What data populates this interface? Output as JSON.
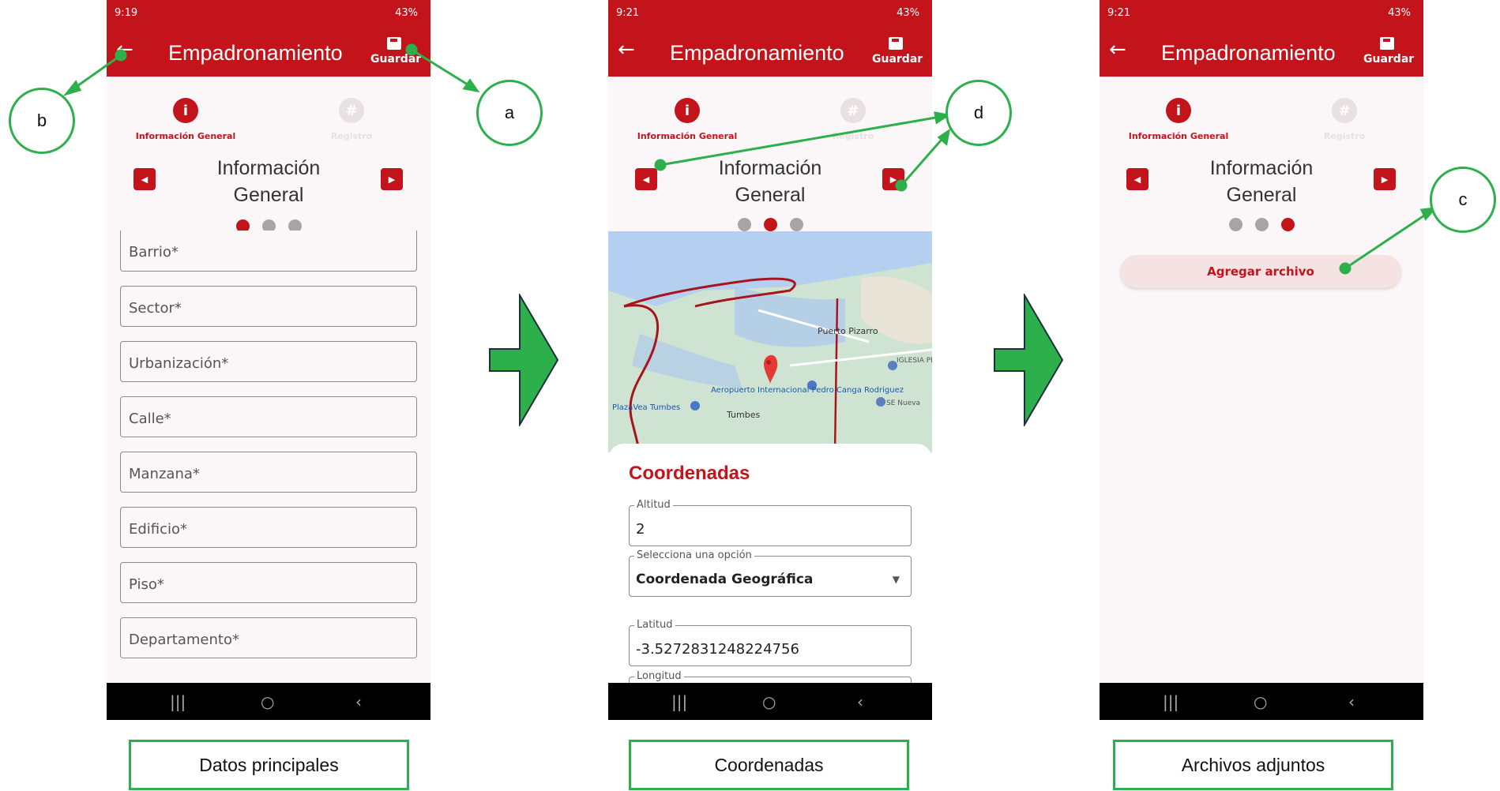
{
  "screens": [
    {
      "status_time": "9:19",
      "status_right": "43%",
      "app_title": "Empadronamiento",
      "save_label": "Guardar",
      "steps": [
        "Información General",
        "Registro"
      ],
      "section_title_1": "Información",
      "section_title_2": "General",
      "fields": [
        "Barrio*",
        "Sector*",
        "Urbanización*",
        "Calle*",
        "Manzana*",
        "Edificio*",
        "Piso*",
        "Departamento*"
      ],
      "caption": "Datos principales"
    },
    {
      "status_time": "9:21",
      "status_right": "43%",
      "app_title": "Empadronamiento",
      "save_label": "Guardar",
      "steps": [
        "Información General",
        "Registro"
      ],
      "section_title_1": "Información",
      "section_title_2": "General",
      "map_labels": [
        "Puerto Pizarro",
        "Aeropuerto Internacional Pedro Canga Rodriguez",
        "Tumbes",
        "PlazaVea Tumbes",
        "IGLESIA PENTE",
        "SE Nueva"
      ],
      "coord_title": "Coordenadas",
      "altitude_label": "Altitud",
      "altitude_value": "2",
      "select_label": "Selecciona una opción",
      "select_value": "Coordenada Geográfica",
      "lat_label": "Latitud",
      "lat_value": "-3.5272831248224756",
      "lon_label": "Longitud",
      "caption": "Coordenadas"
    },
    {
      "status_time": "9:21",
      "status_right": "43%",
      "app_title": "Empadronamiento",
      "save_label": "Guardar",
      "steps": [
        "Información General",
        "Registro"
      ],
      "section_title_1": "Información",
      "section_title_2": "General",
      "add_file": "Agregar archivo",
      "caption": "Archivos adjuntos"
    }
  ],
  "callouts": {
    "a": "a",
    "b": "b",
    "c": "c",
    "d": "d"
  },
  "colors": {
    "brand": "#c4141b",
    "annotation": "#2db04c"
  }
}
